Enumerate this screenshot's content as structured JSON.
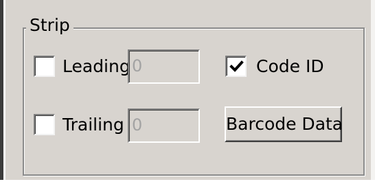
{
  "strip_group": {
    "title": "Strip",
    "leading": {
      "label": "Leading",
      "checked": false,
      "value": "0",
      "enabled": false
    },
    "trailing": {
      "label": "Trailing",
      "checked": false,
      "value": "0",
      "enabled": false
    },
    "code_id": {
      "label": "Code ID",
      "checked": true
    },
    "barcode_data_button": {
      "label": "Barcode Data"
    }
  },
  "colors": {
    "dialog_background": "#d8d4cf",
    "checkbox_background": "#ffffff",
    "disabled_text": "#a3a3a3",
    "text": "#000000"
  }
}
